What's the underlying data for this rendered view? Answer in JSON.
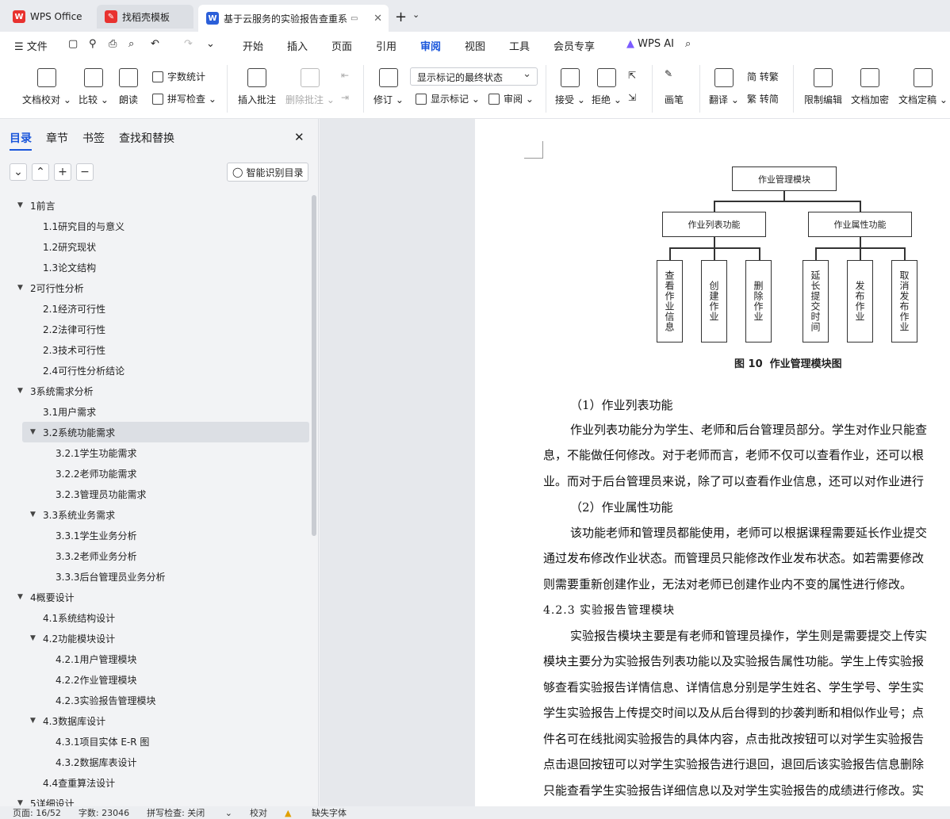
{
  "tabs": [
    {
      "label": "WPS Office"
    },
    {
      "label": "找稻壳模板"
    },
    {
      "label": "基于云服务的实验报告查重系"
    }
  ],
  "menu": {
    "file": "文件",
    "items": [
      "开始",
      "插入",
      "页面",
      "引用",
      "审阅",
      "视图",
      "工具",
      "会员专享"
    ],
    "ai": "WPS AI"
  },
  "ribbon": {
    "proofread": "文档校对",
    "compare": "比较",
    "read": "朗读",
    "wordcount": "字数统计",
    "spellcheck": "拼写检查",
    "insert_comment": "插入批注",
    "delete_comment": "删除批注",
    "revise": "修订",
    "combo": "显示标记的最终状态",
    "show_marks": "显示标记",
    "review": "审阅",
    "accept": "接受",
    "reject": "拒绝",
    "pen": "画笔",
    "translate": "翻译",
    "to_trad": "简 转繁",
    "to_simp": "繁 转简",
    "restrict": "限制编辑",
    "encrypt": "文档加密",
    "finalize": "文档定稿"
  },
  "panel": {
    "tabs": [
      "目录",
      "章节",
      "书签",
      "查找和替换"
    ],
    "smart_button": "智能识别目录",
    "toc": [
      {
        "text": "1前言",
        "level": 0,
        "open": true
      },
      {
        "text": "1.1研究目的与意义",
        "level": 1
      },
      {
        "text": "1.2研究现状",
        "level": 1
      },
      {
        "text": "1.3论文结构",
        "level": 1
      },
      {
        "text": "2可行性分析",
        "level": 0,
        "open": true
      },
      {
        "text": "2.1经济可行性",
        "level": 1
      },
      {
        "text": "2.2法律可行性",
        "level": 1
      },
      {
        "text": "2.3技术可行性",
        "level": 1
      },
      {
        "text": "2.4可行性分析结论",
        "level": 1
      },
      {
        "text": "3系统需求分析",
        "level": 0,
        "open": true
      },
      {
        "text": "3.1用户需求",
        "level": 1
      },
      {
        "text": "3.2系统功能需求",
        "level": 1,
        "open": true,
        "selected": true
      },
      {
        "text": "3.2.1学生功能需求",
        "level": 2
      },
      {
        "text": "3.2.2老师功能需求",
        "level": 2
      },
      {
        "text": "3.2.3管理员功能需求",
        "level": 2
      },
      {
        "text": "3.3系统业务需求",
        "level": 1,
        "open": true
      },
      {
        "text": "3.3.1学生业务分析",
        "level": 2
      },
      {
        "text": "3.3.2老师业务分析",
        "level": 2
      },
      {
        "text": "3.3.3后台管理员业务分析",
        "level": 2
      },
      {
        "text": "4概要设计",
        "level": 0,
        "open": true
      },
      {
        "text": "4.1系统结构设计",
        "level": 1
      },
      {
        "text": "4.2功能模块设计",
        "level": 1,
        "open": true
      },
      {
        "text": "4.2.1用户管理模块",
        "level": 2
      },
      {
        "text": "4.2.2作业管理模块",
        "level": 2
      },
      {
        "text": "4.2.3实验报告管理模块",
        "level": 2
      },
      {
        "text": "4.3数据库设计",
        "level": 1,
        "open": true
      },
      {
        "text": "4.3.1项目实体 E-R 图",
        "level": 2
      },
      {
        "text": "4.3.2数据库表设计",
        "level": 2
      },
      {
        "text": "4.4查重算法设计",
        "level": 1
      },
      {
        "text": "5详细设计",
        "level": 0,
        "open": true
      }
    ]
  },
  "diagram": {
    "root": "作业管理模块",
    "mid": [
      "作业列表功能",
      "作业属性功能"
    ],
    "leaves": [
      "查看作业信息",
      "创建作业",
      "删除作业",
      "延长提交时间",
      "发布作业",
      "取消发布作业"
    ],
    "caption": "图 10  作业管理模块图"
  },
  "doc": {
    "lines": [
      "（1）作业列表功能",
      "作业列表功能分为学生、老师和后台管理员部分。学生对作业只能查",
      "息，不能做任何修改。对于老师而言，老师不仅可以查看作业，还可以根",
      "业。而对于后台管理员来说，除了可以查看作业信息，还可以对作业进行",
      "（2）作业属性功能",
      "该功能老师和管理员都能使用，老师可以根据课程需要延长作业提交",
      "通过发布修改作业状态。而管理员只能修改作业发布状态。如若需要修改",
      "则需要重新创建作业，无法对老师已创建作业内不变的属性进行修改。",
      "4.2.3 实验报告管理模块",
      "实验报告模块主要是有老师和管理员操作，学生则是需要提交上传实",
      "模块主要分为实验报告列表功能以及实验报告属性功能。学生上传实验报",
      "够查看实验报告详情信息、详情信息分别是学生姓名、学生学号、学生实",
      "学生实验报告上传提交时间以及从后台得到的抄袭判断和相似作业号；点",
      "件名可在线批阅实验报告的具体内容，点击批改按钮可以对学生实验报告",
      "点击退回按钮可以对学生实验报告进行退回，退回后该实验报告信息删除",
      "只能查看学生实验报告详细信息以及对学生实验报告的成绩进行修改。实"
    ]
  },
  "status": {
    "page": "页面: 16/52",
    "words": "字数: 23046",
    "spell": "拼写检查: 关闭",
    "proof": "校对",
    "font": "缺失字体"
  }
}
